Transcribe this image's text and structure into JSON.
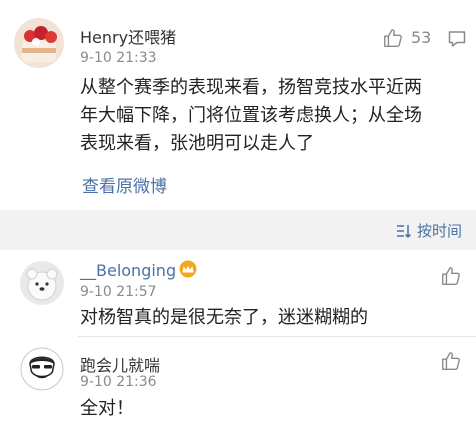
{
  "main_comment": {
    "username": "Henry还喂猪",
    "time": "9-10 21:33",
    "likes": "53",
    "text_lines": [
      "从整个赛季的表现来看，扬智竞技水平近两",
      "年大幅下降，门将位置该考虑换人；从全场",
      "表现来看，张池明可以走人了"
    ],
    "view_original": "查看原微博"
  },
  "sort": {
    "label": "按时间"
  },
  "replies": [
    {
      "username": "__Belonging",
      "time": "9-10 21:57",
      "text": "对杨智真的是很无奈了，迷迷糊糊的"
    },
    {
      "username": "跑会儿就喘",
      "time": "9-10 21:36",
      "text": "全对！"
    }
  ],
  "colors": {
    "link": "#4a72a6",
    "gray": "#8a8a8a",
    "badge": "#f0a91e"
  }
}
